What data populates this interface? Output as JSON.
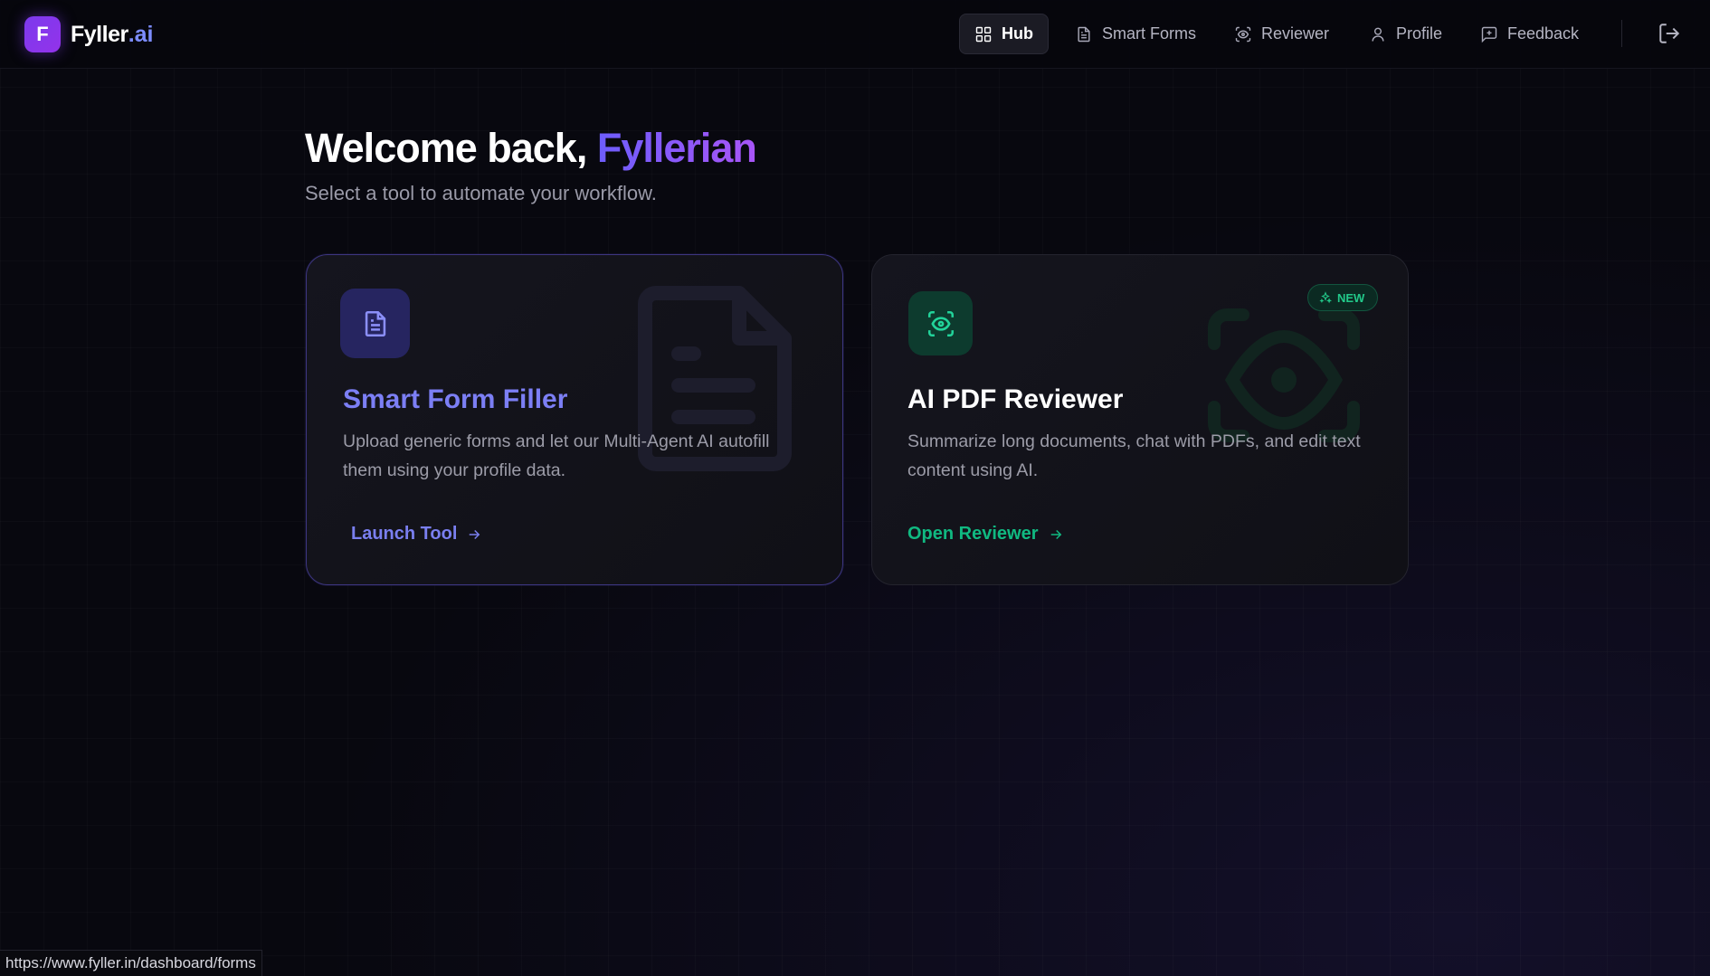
{
  "brand": {
    "badge_letter": "F",
    "name": "Fyller",
    "suffix": ".ai"
  },
  "nav": {
    "items": [
      {
        "label": "Hub",
        "icon": "grid-icon",
        "active": true
      },
      {
        "label": "Smart Forms",
        "icon": "document-icon",
        "active": false
      },
      {
        "label": "Reviewer",
        "icon": "scan-eye-icon",
        "active": false
      },
      {
        "label": "Profile",
        "icon": "user-icon",
        "active": false
      },
      {
        "label": "Feedback",
        "icon": "message-plus-icon",
        "active": false
      }
    ],
    "logout_icon": "logout-icon"
  },
  "hero": {
    "greeting": "Welcome back, ",
    "name": "Fyllerian",
    "subtitle": "Select a tool to automate your workflow."
  },
  "cards": [
    {
      "title": "Smart Form Filler",
      "description": "Upload generic forms and let our Multi-Agent AI autofill them using your profile data.",
      "action": "Launch Tool",
      "icon": "document-icon",
      "accent": "#7c7ff5"
    },
    {
      "title": "AI PDF Reviewer",
      "description": "Summarize long documents, chat with PDFs, and edit text content using AI.",
      "action": "Open Reviewer",
      "badge": "NEW",
      "icon": "scan-eye-icon",
      "accent": "#10b981"
    }
  ],
  "status_bar": {
    "url": "https://www.fyller.in/dashboard/forms"
  },
  "colors": {
    "background": "#08080f",
    "brand_purple": "#7c3aed",
    "indigo_accent": "#7c7ff5",
    "green_accent": "#10b981"
  }
}
